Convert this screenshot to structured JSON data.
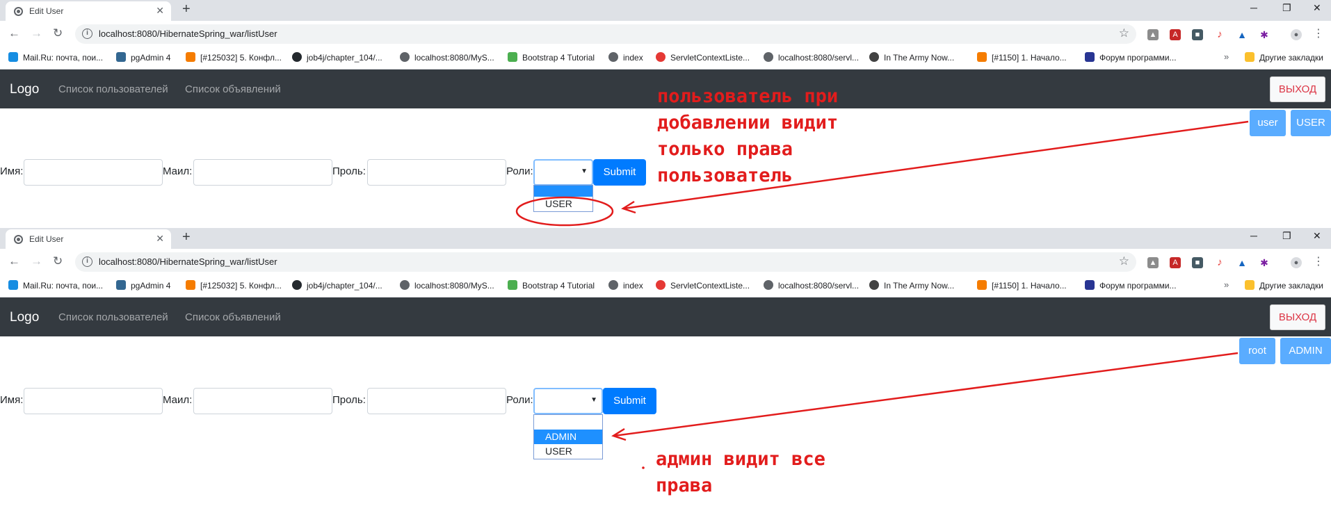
{
  "browser": {
    "tab_title": "Edit User",
    "tab_close": "✕",
    "new_tab": "+",
    "minimize": "─",
    "restore": "❐",
    "close": "✕",
    "url": "localhost:8080/HibernateSpring_war/listUser",
    "bookmarks": [
      {
        "label": "Mail.Ru: почта, пои...",
        "color": "#168de2"
      },
      {
        "label": "pgAdmin 4",
        "color": "#336791"
      },
      {
        "label": "[#125032] 5. Конфл...",
        "color": "#f57c00"
      },
      {
        "label": "job4j/chapter_104/...",
        "color": "#24292e"
      },
      {
        "label": "localhost:8080/MyS...",
        "color": "#5f6368"
      },
      {
        "label": "Bootstrap 4 Tutorial",
        "color": "#4caf50"
      },
      {
        "label": "index",
        "color": "#5f6368"
      },
      {
        "label": "ServletContextListe...",
        "color": "#e53935"
      },
      {
        "label": "localhost:8080/servl...",
        "color": "#5f6368"
      },
      {
        "label": "In The Army Now...",
        "color": "#424242"
      },
      {
        "label": "[#1150] 1. Начало...",
        "color": "#f57c00"
      },
      {
        "label": "Форум программи...",
        "color": "#283593"
      }
    ],
    "bookmarks_more": "»",
    "other_bookmarks": "Другие закладки"
  },
  "site": {
    "logo": "Logo",
    "nav_users": "Список пользователей",
    "nav_ads": "Список объявлений",
    "logout": "ВЫХОД"
  },
  "form": {
    "name_label": "Имя:",
    "mail_label": "Маил:",
    "password_label": "Проль:",
    "roles_label": "Роли:",
    "submit": "Submit"
  },
  "panels": {
    "user": {
      "username": "user",
      "role_badge": "USER",
      "dropdown_options": [
        "",
        "USER"
      ],
      "annotation": "пользователь при\nдобавлении видит\nтолько права\nпользователь"
    },
    "admin": {
      "username": "root",
      "role_badge": "ADMIN",
      "dropdown_options": [
        "",
        "ADMIN",
        "USER"
      ],
      "highlighted_option": "ADMIN",
      "annotation": "админ видит все\nправа"
    }
  },
  "colors": {
    "navbar": "#343a40",
    "primary": "#007bff",
    "badge": "#5aacff",
    "annotation": "#e21c1c",
    "logout_text": "#dc3545"
  }
}
